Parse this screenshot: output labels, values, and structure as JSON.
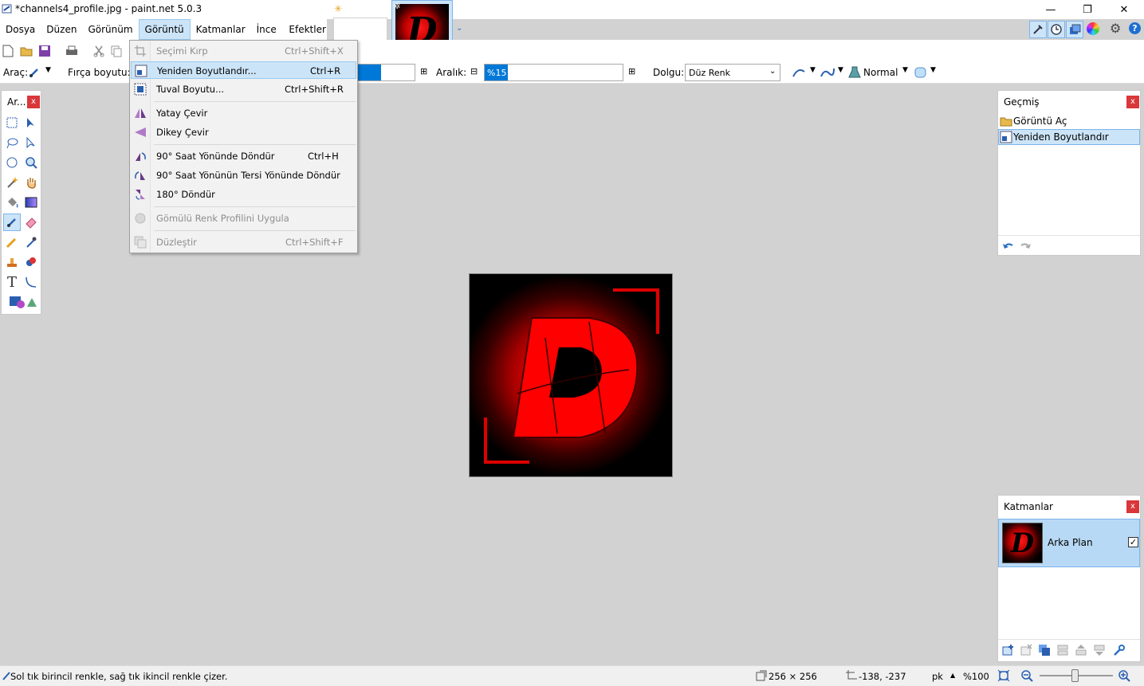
{
  "window": {
    "title": "*channels4_profile.jpg - paint.net 5.0.3",
    "controls": {
      "minimize": "—",
      "maximize": "❐",
      "close": "✕"
    }
  },
  "menu": {
    "items": [
      "Dosya",
      "Düzen",
      "Görünüm",
      "Görüntü",
      "Katmanlar",
      "İnce Ayar",
      "Efektler"
    ]
  },
  "dropdown": {
    "items": [
      {
        "label": "Seçimi Kırp",
        "shortcut": "Ctrl+Shift+X",
        "icon": "crop-icon"
      },
      {
        "label": "Yeniden Boyutlandır...",
        "shortcut": "Ctrl+R",
        "icon": "resize-icon"
      },
      {
        "label": "Tuval Boyutu...",
        "shortcut": "Ctrl+Shift+R",
        "icon": "canvas-size-icon"
      },
      {
        "label": "Yatay Çevir",
        "shortcut": "",
        "icon": "flip-horizontal-icon"
      },
      {
        "label": "Dikey Çevir",
        "shortcut": "",
        "icon": "flip-vertical-icon"
      },
      {
        "label": "90° Saat Yönünde Döndür",
        "shortcut": "Ctrl+H",
        "icon": "rotate-cw-icon"
      },
      {
        "label": "90° Saat Yönünün Tersi Yönünde Döndür",
        "shortcut": "",
        "icon": "rotate-ccw-icon"
      },
      {
        "label": "180° Döndür",
        "shortcut": "",
        "icon": "rotate-180-icon"
      },
      {
        "label": "Gömülü Renk Profilini Uygula",
        "shortcut": "",
        "icon": "color-profile-icon"
      },
      {
        "label": "Düzleştir",
        "shortcut": "Ctrl+Shift+F",
        "icon": "flatten-icon"
      }
    ]
  },
  "toolbar": {
    "tool_label": "Araç:",
    "brush_size_label": "Fırça boyutu:",
    "spacing_label": "Aralık:",
    "spacing_value": "%15",
    "fill_label": "Dolgu:",
    "fill_value": "Düz Renk",
    "blend_mode": "Normal"
  },
  "tools_panel": {
    "title": "Ar..."
  },
  "history_panel": {
    "title": "Geçmiş",
    "items": [
      "Görüntü Aç",
      "Yeniden Boyutlandır"
    ]
  },
  "layers_panel": {
    "title": "Katmanlar",
    "layer_name": "Arka Plan"
  },
  "status": {
    "hint": "Sol tık birincil renkle, sağ tık ikincil renkle çizer.",
    "image_size": "256 × 256",
    "cursor_pos": "-138, -237",
    "unit": "pk",
    "zoom": "%100"
  },
  "colors": {
    "accent": "#cce4f7",
    "accent_border": "#7eb4ea",
    "close_red": "#d9373a",
    "image_red": "#ff0a0a"
  }
}
